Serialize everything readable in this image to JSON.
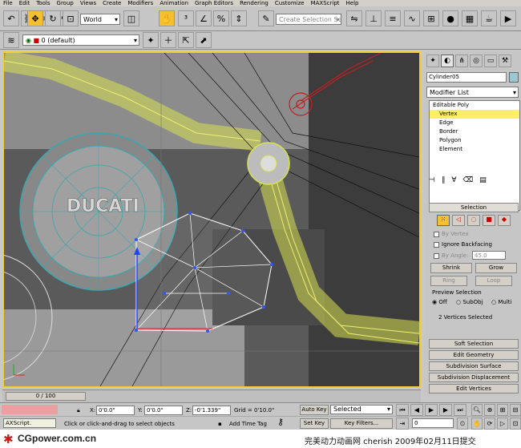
{
  "menu": [
    "File",
    "Edit",
    "Tools",
    "Group",
    "Views",
    "Create",
    "Modifiers",
    "Animation",
    "Graph Editors",
    "Rendering",
    "Customize",
    "MAXScript",
    "Help"
  ],
  "toolbar": {
    "reference_coord": "World",
    "named_selection_placeholder": "Create Selection Se"
  },
  "layer": {
    "name": "0 (default)"
  },
  "panel": {
    "object_name": "Cylinder05",
    "modifier_list": "Modifier List",
    "stack": [
      {
        "label": "Editable Poly",
        "selected": false
      },
      {
        "label": "Vertex",
        "selected": true
      },
      {
        "label": "Edge",
        "selected": false
      },
      {
        "label": "Border",
        "selected": false
      },
      {
        "label": "Polygon",
        "selected": false
      },
      {
        "label": "Element",
        "selected": false
      }
    ],
    "selection": {
      "title": "Selection",
      "by_vertex": "By Vertex",
      "ignore_backfacing": "Ignore Backfacing",
      "by_angle": "By Angle:",
      "angle_value": "45.0",
      "shrink": "Shrink",
      "grow": "Grow",
      "ring": "Ring",
      "loop": "Loop",
      "preview_title": "Preview Selection",
      "preview_options": [
        "Off",
        "SubObj",
        "Multi"
      ],
      "status": "2 Vertices Selected"
    },
    "rollouts": [
      "Soft Selection",
      "Edit Geometry",
      "Subdivision Surface",
      "Subdivision Displacement",
      "Edit Vertices"
    ]
  },
  "timeline": {
    "frame": "0 / 100"
  },
  "status": {
    "x_label": "X:",
    "x_value": "0'0.0\"",
    "y_label": "Y:",
    "y_value": "0'0.0\"",
    "z_label": "Z:",
    "z_value": "-0'1.339\"",
    "grid": "Grid = 0'10.0\"",
    "auto_key": "Auto Key",
    "key_mode": "Selected",
    "set_key": "Set Key",
    "key_filters": "Key Filters...",
    "frame_field": "0",
    "maxscript": "AXScript.",
    "prompt": "Click or click-and-drag to select objects",
    "add_time_tag": "Add Time Tag"
  },
  "watermark": {
    "left": "CGpower.com.cn",
    "right": "完美动力动画网 cherish 2009年02月11日提交"
  },
  "colors": {
    "accent": "#f0d030",
    "selection_yellow": "#ffef66",
    "watermark_red": "#d01818"
  }
}
